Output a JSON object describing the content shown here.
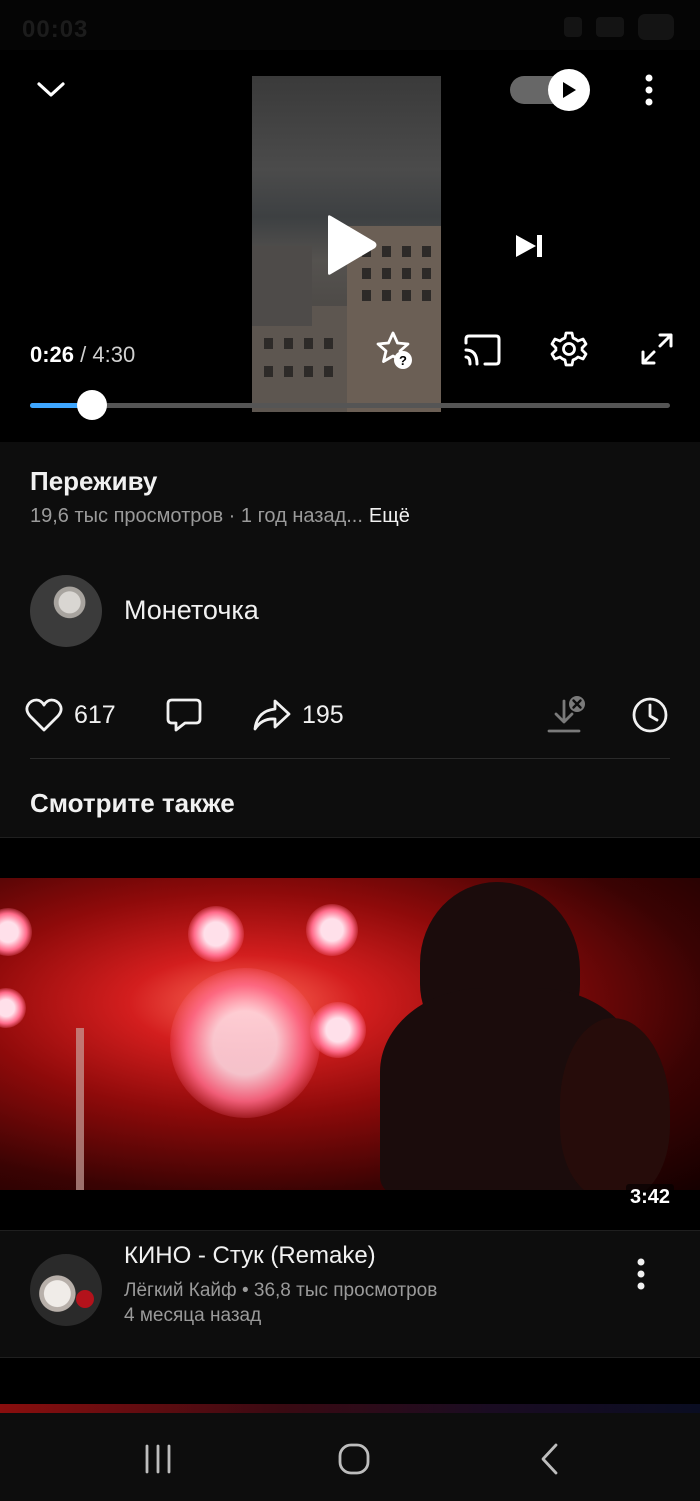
{
  "status_bar": {
    "time": "00:03"
  },
  "player": {
    "current_time": "0:26",
    "separator": "/",
    "duration": "4:30",
    "progress": 0.097,
    "autoplay": true,
    "accent_color": "#3ea6ff"
  },
  "video": {
    "title": "Переживу",
    "meta": "19,6 тыс просмотров · 1 год назад...",
    "more_label": "Ещё"
  },
  "channel": {
    "name": "Монеточка"
  },
  "actions": {
    "likes": "617",
    "shares": "195"
  },
  "recommendations": {
    "section_title": "Смотрите также",
    "items": [
      {
        "title": "КИНО - Стук (Remake)",
        "meta_line1": "Лёгкий Кайф • 36,8 тыс просмотров",
        "meta_line2": "4 месяца назад",
        "duration": "3:42"
      }
    ]
  },
  "icons": {
    "collapse": "chevron-down-icon",
    "autoplay": "play-icon",
    "more": "more-vertical-icon",
    "play": "play-icon",
    "next": "skip-next-icon",
    "rate": "star-question-icon",
    "cast": "cast-icon",
    "settings": "gear-icon",
    "fullscreen": "fullscreen-icon",
    "like": "heart-icon",
    "comment": "comment-icon",
    "share": "share-icon",
    "download": "download-disabled-icon",
    "watch_later": "clock-icon"
  }
}
